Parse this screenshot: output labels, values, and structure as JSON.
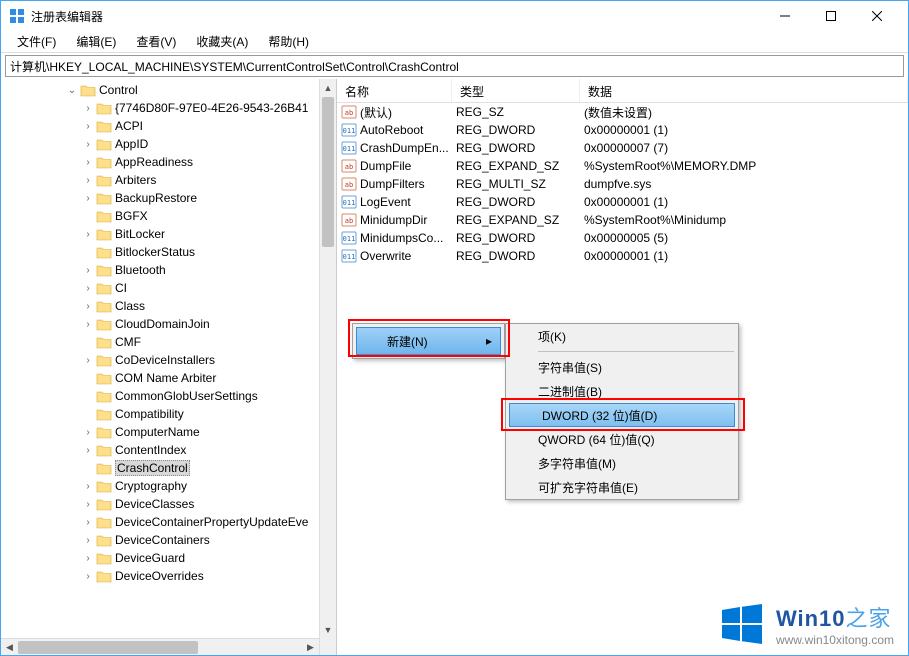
{
  "window": {
    "title": "注册表编辑器"
  },
  "menubar": [
    "文件(F)",
    "编辑(E)",
    "查看(V)",
    "收藏夹(A)",
    "帮助(H)"
  ],
  "address": "计算机\\HKEY_LOCAL_MACHINE\\SYSTEM\\CurrentControlSet\\Control\\CrashControl",
  "tree": {
    "root_label": "Control",
    "items": [
      {
        "indent": 4,
        "expander": "open",
        "label": "Control"
      },
      {
        "indent": 5,
        "expander": "closed",
        "label": "{7746D80F-97E0-4E26-9543-26B41"
      },
      {
        "indent": 5,
        "expander": "closed",
        "label": "ACPI"
      },
      {
        "indent": 5,
        "expander": "closed",
        "label": "AppID"
      },
      {
        "indent": 5,
        "expander": "closed",
        "label": "AppReadiness"
      },
      {
        "indent": 5,
        "expander": "closed",
        "label": "Arbiters"
      },
      {
        "indent": 5,
        "expander": "closed",
        "label": "BackupRestore"
      },
      {
        "indent": 5,
        "expander": "none",
        "label": "BGFX"
      },
      {
        "indent": 5,
        "expander": "closed",
        "label": "BitLocker"
      },
      {
        "indent": 5,
        "expander": "none",
        "label": "BitlockerStatus"
      },
      {
        "indent": 5,
        "expander": "closed",
        "label": "Bluetooth"
      },
      {
        "indent": 5,
        "expander": "closed",
        "label": "CI"
      },
      {
        "indent": 5,
        "expander": "closed",
        "label": "Class"
      },
      {
        "indent": 5,
        "expander": "closed",
        "label": "CloudDomainJoin"
      },
      {
        "indent": 5,
        "expander": "none",
        "label": "CMF"
      },
      {
        "indent": 5,
        "expander": "closed",
        "label": "CoDeviceInstallers"
      },
      {
        "indent": 5,
        "expander": "none",
        "label": "COM Name Arbiter"
      },
      {
        "indent": 5,
        "expander": "none",
        "label": "CommonGlobUserSettings"
      },
      {
        "indent": 5,
        "expander": "none",
        "label": "Compatibility"
      },
      {
        "indent": 5,
        "expander": "closed",
        "label": "ComputerName"
      },
      {
        "indent": 5,
        "expander": "closed",
        "label": "ContentIndex"
      },
      {
        "indent": 5,
        "expander": "none",
        "label": "CrashControl",
        "selected": true
      },
      {
        "indent": 5,
        "expander": "closed",
        "label": "Cryptography"
      },
      {
        "indent": 5,
        "expander": "closed",
        "label": "DeviceClasses"
      },
      {
        "indent": 5,
        "expander": "closed",
        "label": "DeviceContainerPropertyUpdateEve"
      },
      {
        "indent": 5,
        "expander": "closed",
        "label": "DeviceContainers"
      },
      {
        "indent": 5,
        "expander": "closed",
        "label": "DeviceGuard"
      },
      {
        "indent": 5,
        "expander": "closed",
        "label": "DeviceOverrides"
      }
    ]
  },
  "list": {
    "columns": {
      "name": "名称",
      "type": "类型",
      "data": "数据"
    },
    "rows": [
      {
        "icon": "sz",
        "name": "(默认)",
        "type": "REG_SZ",
        "data": "(数值未设置)"
      },
      {
        "icon": "dw",
        "name": "AutoReboot",
        "type": "REG_DWORD",
        "data": "0x00000001 (1)"
      },
      {
        "icon": "dw",
        "name": "CrashDumpEn...",
        "type": "REG_DWORD",
        "data": "0x00000007 (7)"
      },
      {
        "icon": "sz",
        "name": "DumpFile",
        "type": "REG_EXPAND_SZ",
        "data": "%SystemRoot%\\MEMORY.DMP"
      },
      {
        "icon": "sz",
        "name": "DumpFilters",
        "type": "REG_MULTI_SZ",
        "data": "dumpfve.sys"
      },
      {
        "icon": "dw",
        "name": "LogEvent",
        "type": "REG_DWORD",
        "data": "0x00000001 (1)"
      },
      {
        "icon": "sz",
        "name": "MinidumpDir",
        "type": "REG_EXPAND_SZ",
        "data": "%SystemRoot%\\Minidump"
      },
      {
        "icon": "dw",
        "name": "MinidumpsCo...",
        "type": "REG_DWORD",
        "data": "0x00000005 (5)"
      },
      {
        "icon": "dw",
        "name": "Overwrite",
        "type": "REG_DWORD",
        "data": "0x00000001 (1)"
      }
    ]
  },
  "context1": {
    "new": "新建(N)"
  },
  "context2": {
    "key": "项(K)",
    "string": "字符串值(S)",
    "binary": "二进制值(B)",
    "dword": "DWORD (32 位)值(D)",
    "qword": "QWORD (64 位)值(Q)",
    "multi": "多字符串值(M)",
    "expand": "可扩充字符串值(E)"
  },
  "watermark": {
    "brand1": "Win10",
    "brand2": "之家",
    "url": "www.win10xitong.com"
  }
}
